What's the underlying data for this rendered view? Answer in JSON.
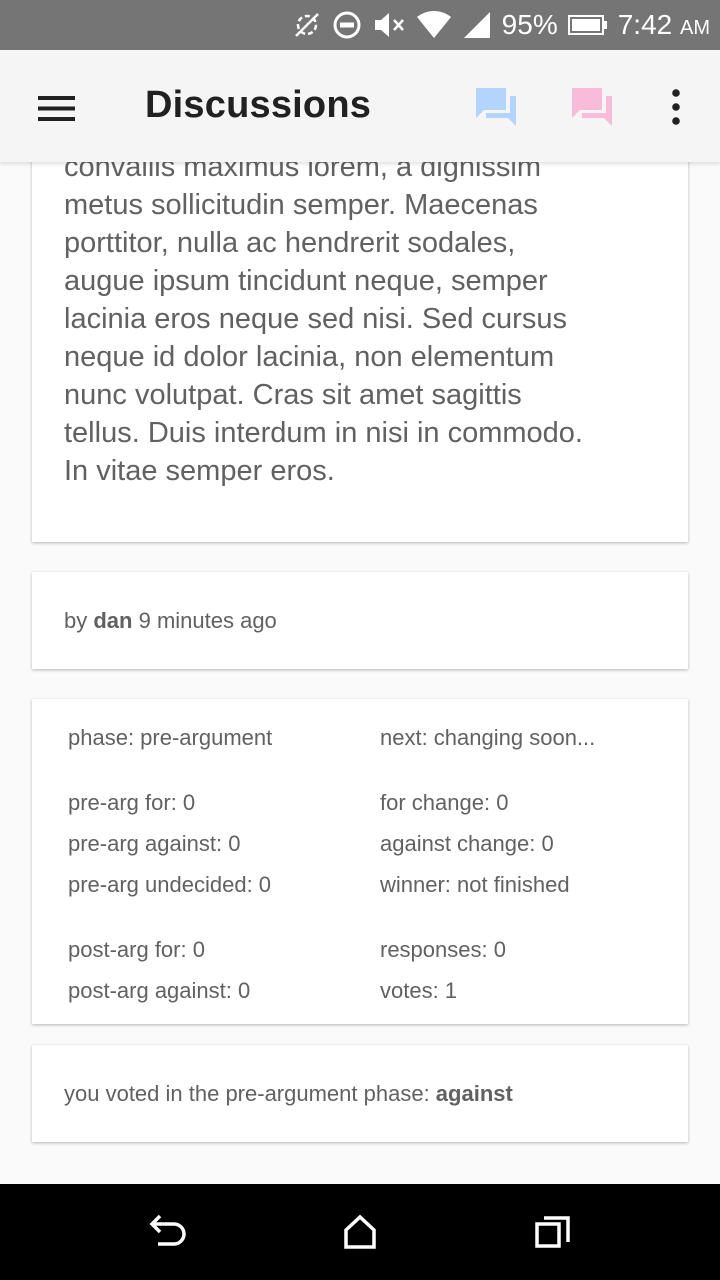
{
  "status_bar": {
    "battery": "95%",
    "time": "7:42",
    "ampm": "AM",
    "icons": [
      "no-sync-icon",
      "do-not-disturb-icon",
      "volume-mute-icon",
      "wifi-icon",
      "signal-icon",
      "battery-icon"
    ]
  },
  "app_bar": {
    "title": "Discussions",
    "icons": [
      "menu-icon",
      "chat-blue-icon",
      "chat-pink-icon",
      "overflow-menu-icon"
    ],
    "colors": {
      "chat_blue": "#b3d4fc",
      "chat_pink": "#f8bbd9"
    }
  },
  "post": {
    "lines": [
      "convallis maximus lorem, a dignissim",
      "metus sollicitudin semper. Maecenas",
      "porttitor, nulla ac hendrerit sodales,",
      "augue ipsum tincidunt neque, semper",
      "lacinia eros neque sed nisi. Sed cursus",
      "neque id dolor lacinia, non elementum",
      "nunc volutpat. Cras sit amet sagittis",
      "tellus. Duis interdum in nisi in commodo.",
      "In vitae semper eros."
    ]
  },
  "author": {
    "prefix": "by ",
    "name": "dan",
    "time": " 9 minutes ago"
  },
  "stats": {
    "phase": "phase: pre-argument",
    "next": "next: changing soon...",
    "pre_for": "pre-arg for: 0",
    "for_change": "for change: 0",
    "pre_against": "pre-arg against: 0",
    "against_change": "against change: 0",
    "pre_undecided": "pre-arg undecided: 0",
    "winner": "winner: not finished",
    "post_for": "post-arg for: 0",
    "responses": "responses: 0",
    "post_against": "post-arg against: 0",
    "votes": "votes: 1"
  },
  "vote": {
    "prefix": "you voted in the pre-argument phase: ",
    "choice": "against"
  },
  "nav_bar": {
    "icons": [
      "back-icon",
      "home-icon",
      "recents-icon"
    ]
  }
}
